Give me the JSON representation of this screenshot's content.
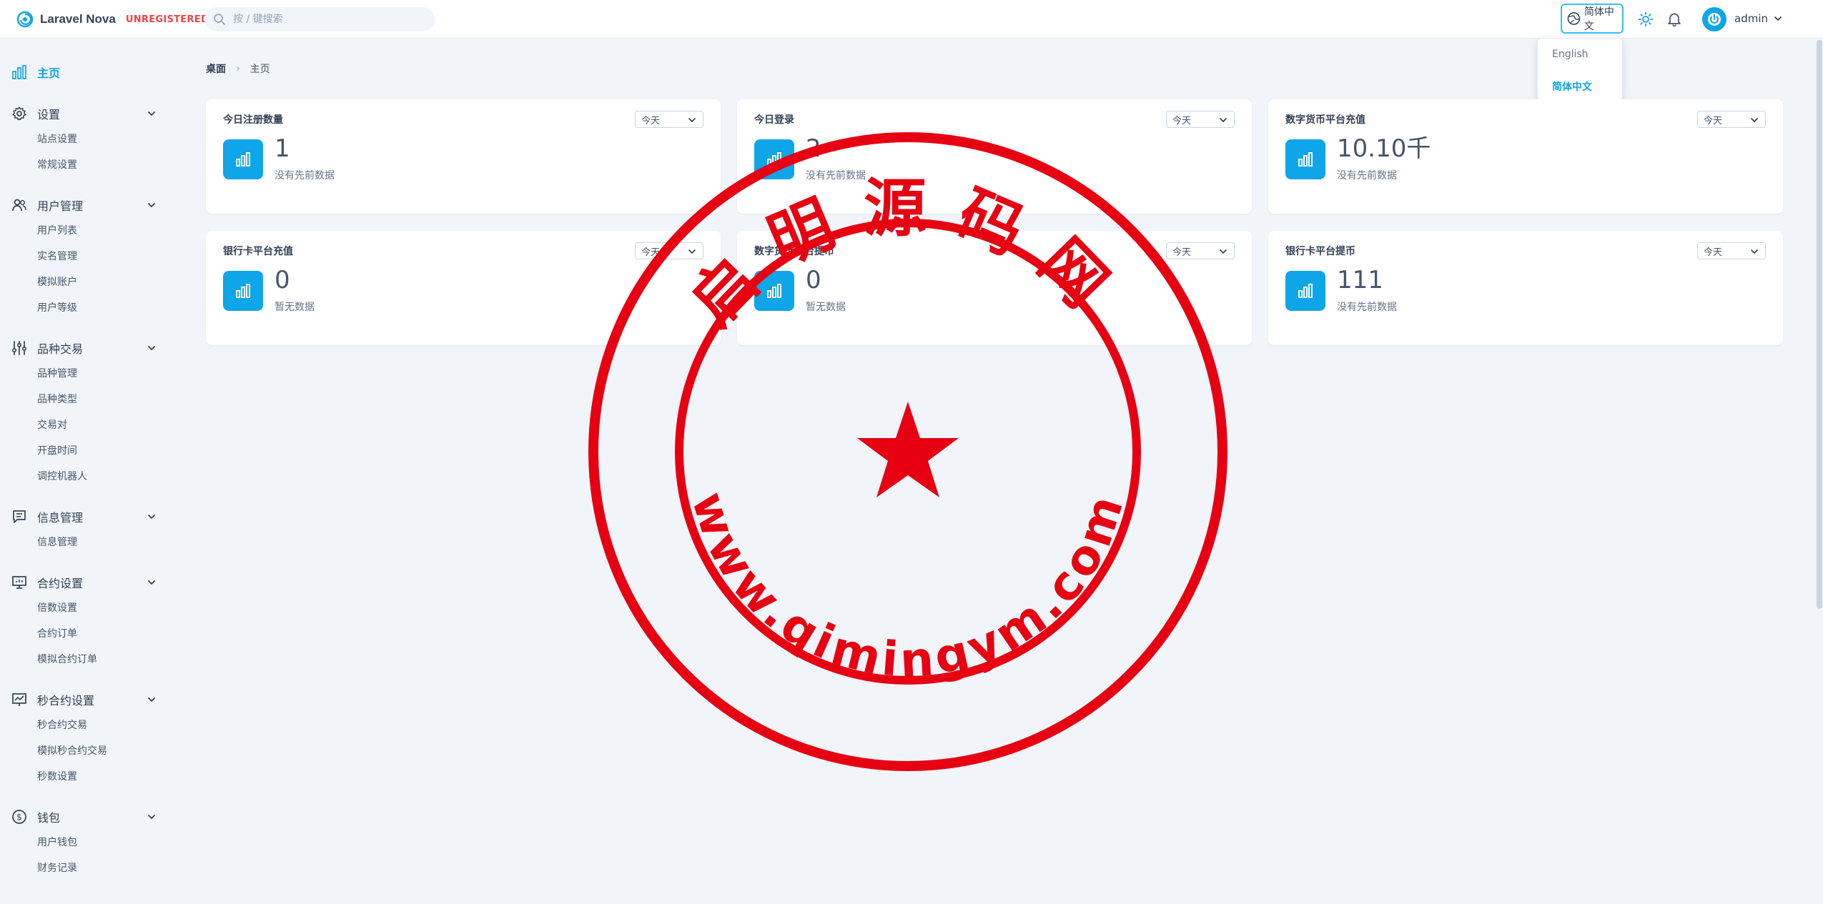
{
  "header": {
    "app_name": "Laravel Nova",
    "license_badge": "UNREGISTERED",
    "search_placeholder": "按 / 键搜索",
    "language_current": "简体中文",
    "user_name": "admin"
  },
  "language_menu": {
    "options": [
      {
        "label": "English",
        "selected": false
      },
      {
        "label": "简体中文",
        "selected": true
      }
    ]
  },
  "sidebar": {
    "sections": [
      {
        "label": "主页",
        "icon": "chart-bar-icon",
        "active": true,
        "items": []
      },
      {
        "label": "设置",
        "icon": "gear-icon",
        "items": [
          "站点设置",
          "常规设置"
        ]
      },
      {
        "label": "用户管理",
        "icon": "users-icon",
        "items": [
          "用户列表",
          "实名管理",
          "模拟账户",
          "用户等级"
        ]
      },
      {
        "label": "品种交易",
        "icon": "sliders-icon",
        "items": [
          "品种管理",
          "品种类型",
          "交易对",
          "开盘时间",
          "调控机器人"
        ]
      },
      {
        "label": "信息管理",
        "icon": "message-icon",
        "items": [
          "信息管理"
        ]
      },
      {
        "label": "合约设置",
        "icon": "presentation-chart-icon",
        "items": [
          "倍数设置",
          "合约订单",
          "模拟合约订单"
        ]
      },
      {
        "label": "秒合约设置",
        "icon": "trend-chart-icon",
        "items": [
          "秒合约交易",
          "模拟秒合约交易",
          "秒数设置"
        ]
      },
      {
        "label": "钱包",
        "icon": "currency-icon",
        "items": [
          "用户钱包",
          "财务记录"
        ]
      }
    ]
  },
  "breadcrumb": {
    "root": "桌面",
    "current": "主页"
  },
  "cards": [
    {
      "title": "今日注册数量",
      "range": "今天",
      "value": "1",
      "sub": "没有先前数据"
    },
    {
      "title": "今日登录",
      "range": "今天",
      "value": "2",
      "sub": "没有先前数据"
    },
    {
      "title": "数字货币平台充值",
      "range": "今天",
      "value": "10.10千",
      "sub": "没有先前数据"
    },
    {
      "title": "银行卡平台充值",
      "range": "今天",
      "value": "0",
      "sub": "暂无数据"
    },
    {
      "title": "数字货币平台提币",
      "range": "今天",
      "value": "0",
      "sub": "暂无数据"
    },
    {
      "title": "银行卡平台提币",
      "range": "今天",
      "value": "111",
      "sub": "没有先前数据"
    }
  ],
  "watermark": {
    "top_text": "启明源码网",
    "bottom_text": "www.qimingym.com"
  },
  "colors": {
    "accent": "#0ea5e9",
    "danger": "#ef4444",
    "seal": "#e60012"
  }
}
